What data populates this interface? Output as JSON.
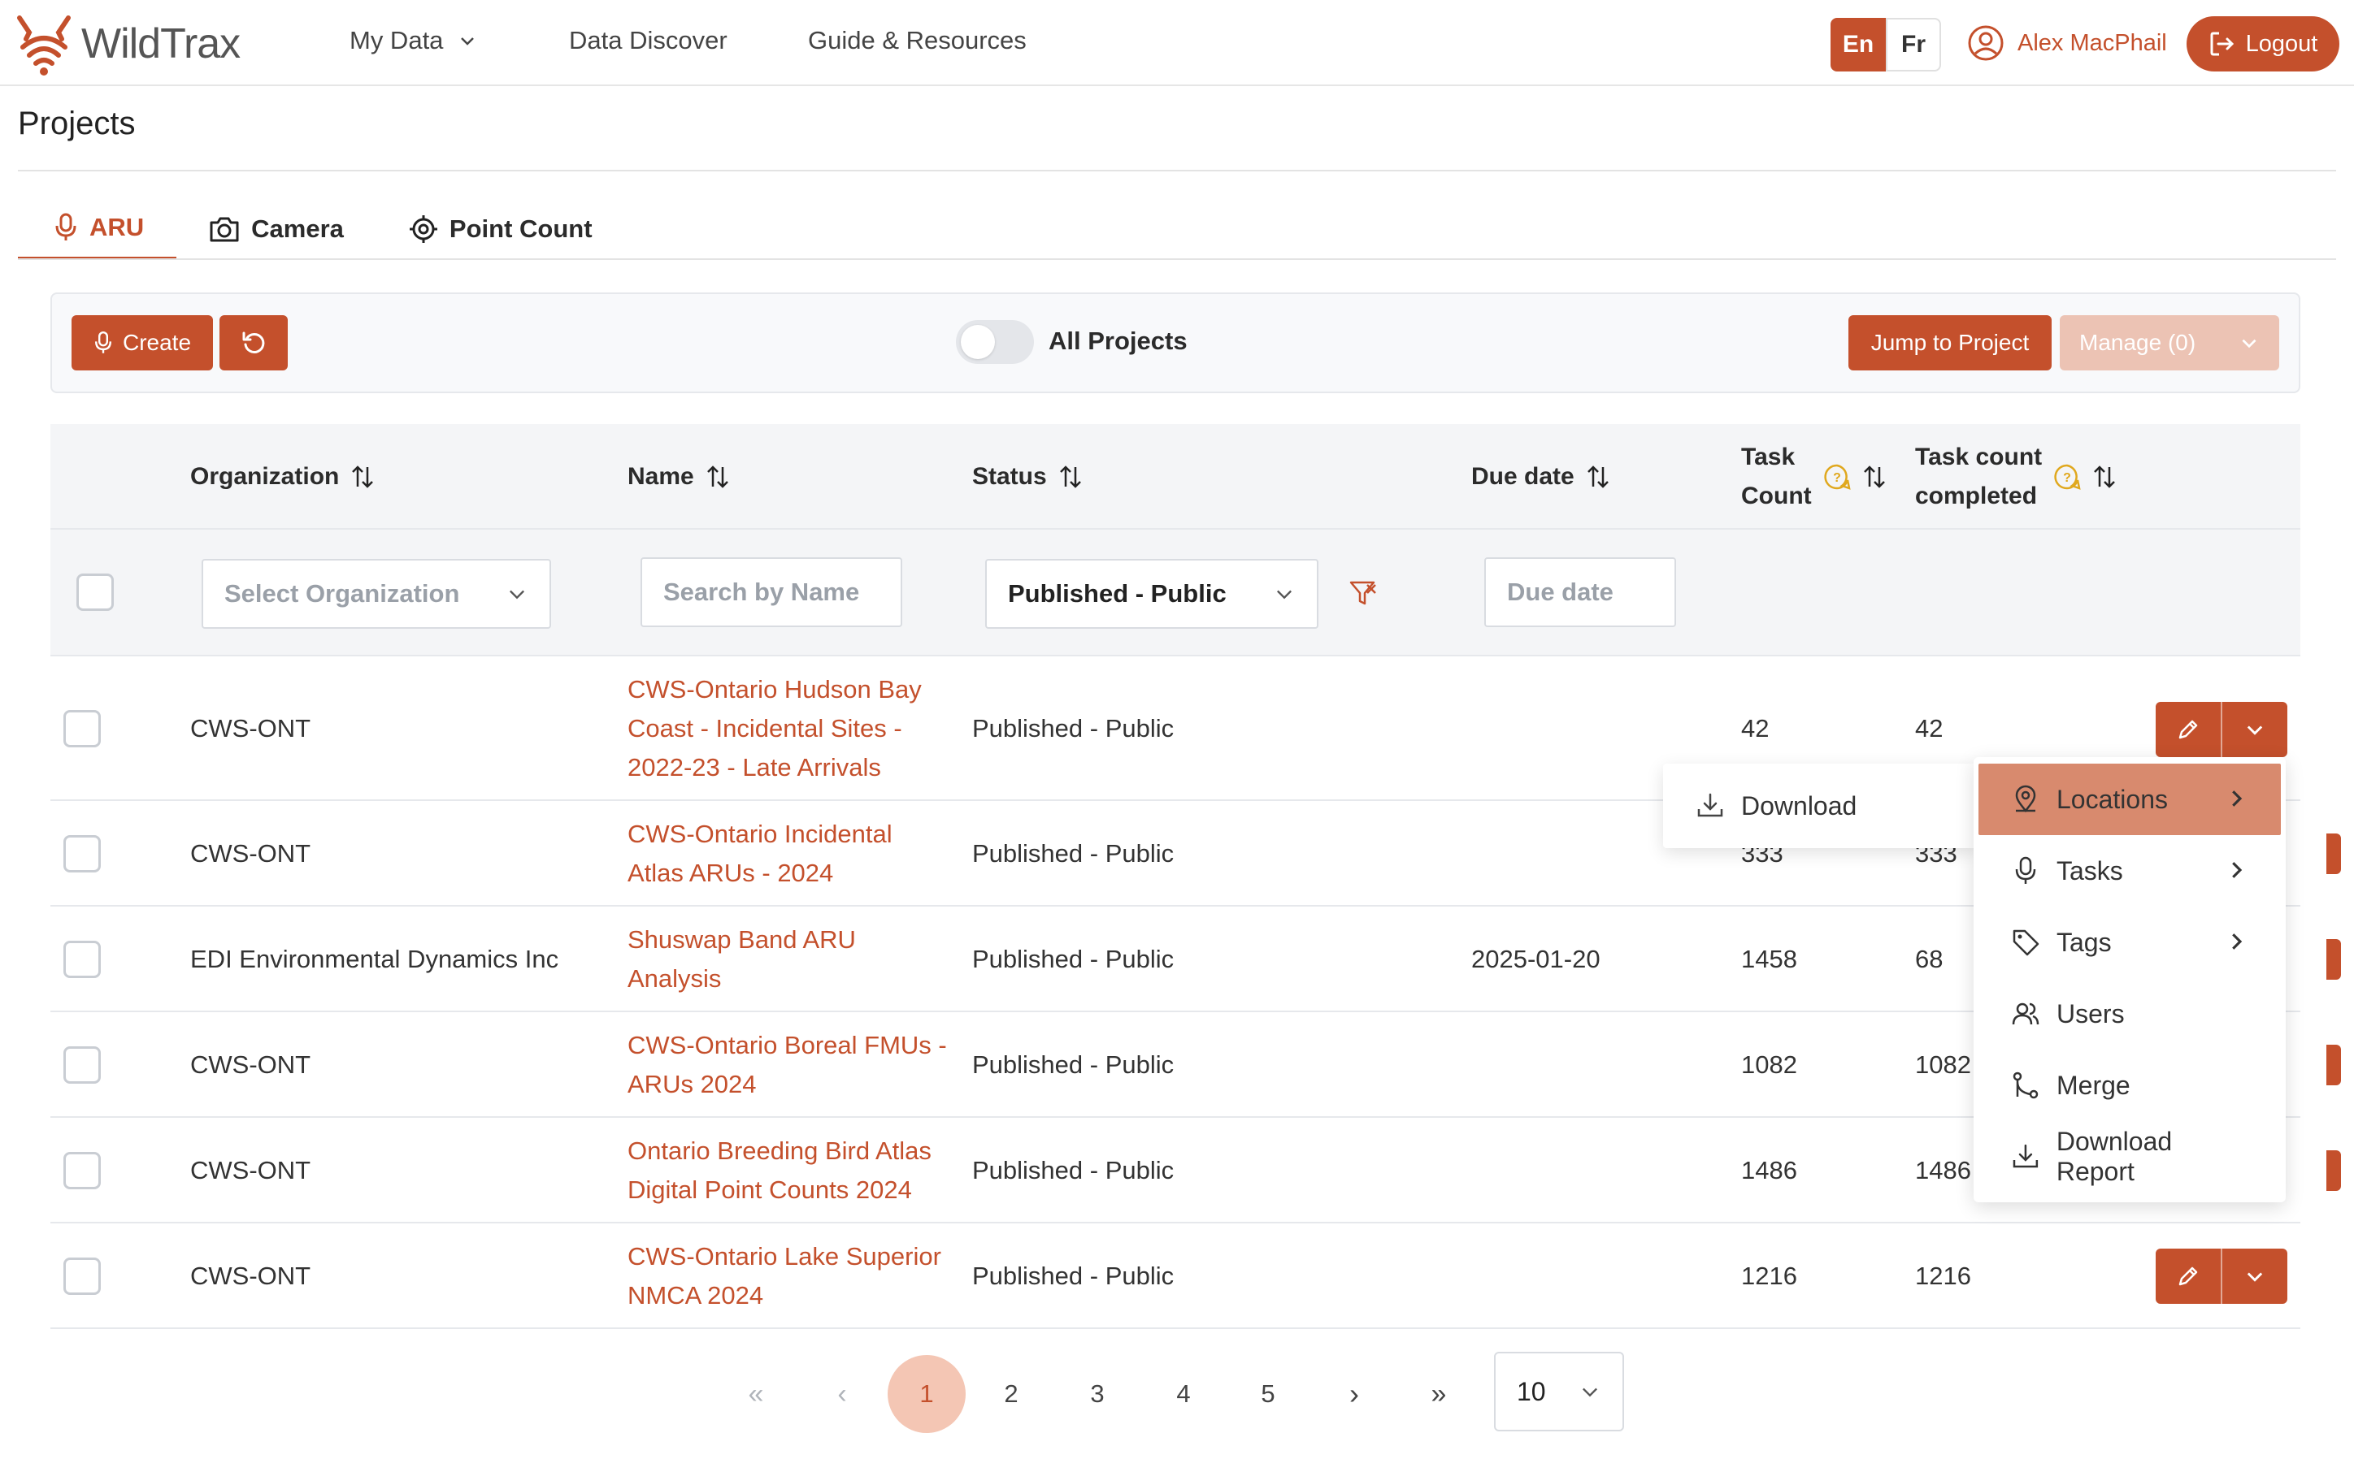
{
  "brand": {
    "name": "WildTrax",
    "accent": "#c4502c",
    "accent_light": "#f4c6b4"
  },
  "nav": {
    "items": [
      "My Data",
      "Data Discover",
      "Guide & Resources"
    ],
    "lang": {
      "en": "En",
      "fr": "Fr",
      "active": "En"
    },
    "user_name": "Alex MacPhail",
    "logout": "Logout"
  },
  "page": {
    "title": "Projects"
  },
  "tabs": [
    {
      "label": "ARU",
      "icon": "microphone-icon",
      "active": true
    },
    {
      "label": "Camera",
      "icon": "camera-icon",
      "active": false
    },
    {
      "label": "Point Count",
      "icon": "crosshair-icon",
      "active": false
    }
  ],
  "toolbar": {
    "create": "Create",
    "all_projects": "All Projects",
    "all_projects_on": false,
    "jump": "Jump to Project",
    "manage": "Manage (0)"
  },
  "table": {
    "headers": {
      "organization": "Organization",
      "name": "Name",
      "status": "Status",
      "due_date": "Due date",
      "task_count_1": "Task",
      "task_count_2": "Count",
      "task_completed_1": "Task count",
      "task_completed_2": "completed"
    },
    "filters": {
      "organization_placeholder": "Select Organization",
      "name_placeholder": "Search by Name",
      "status_value": "Published - Public",
      "due_placeholder": "Due date"
    },
    "rows": [
      {
        "organization": "CWS-ONT",
        "name": [
          "CWS-Ontario Hudson Bay",
          "Coast - Incidental Sites -",
          "2022-23 - Late Arrivals"
        ],
        "status": "Published - Public",
        "due": "",
        "tasks": "42",
        "completed": "42"
      },
      {
        "organization": "CWS-ONT",
        "name": [
          "CWS-Ontario Incidental",
          "Atlas ARUs - 2024"
        ],
        "status": "Published - Public",
        "due": "",
        "tasks": "333",
        "completed": "333"
      },
      {
        "organization": "EDI Environmental Dynamics Inc",
        "name": [
          "Shuswap Band ARU",
          "Analysis"
        ],
        "status": "Published - Public",
        "due": "2025-01-20",
        "tasks": "1458",
        "completed": "68"
      },
      {
        "organization": "CWS-ONT",
        "name": [
          "CWS-Ontario Boreal FMUs -",
          "ARUs 2024"
        ],
        "status": "Published - Public",
        "due": "",
        "tasks": "1082",
        "completed": "1082"
      },
      {
        "organization": "CWS-ONT",
        "name": [
          "Ontario Breeding Bird Atlas",
          "Digital Point Counts 2024"
        ],
        "status": "Published - Public",
        "due": "",
        "tasks": "1486",
        "completed": "1486"
      },
      {
        "organization": "CWS-ONT",
        "name": [
          "CWS-Ontario Lake Superior",
          "NMCA 2024"
        ],
        "status": "Published - Public",
        "due": "",
        "tasks": "1216",
        "completed": "1216"
      }
    ]
  },
  "download_menu": {
    "label": "Download"
  },
  "actions_menu": [
    {
      "label": "Locations",
      "icon": "location-icon",
      "submenu": true,
      "highlighted": true
    },
    {
      "label": "Tasks",
      "icon": "microphone-icon",
      "submenu": true,
      "highlighted": false
    },
    {
      "label": "Tags",
      "icon": "tag-icon",
      "submenu": true,
      "highlighted": false
    },
    {
      "label": "Users",
      "icon": "users-icon",
      "submenu": false,
      "highlighted": false
    },
    {
      "label": "Merge",
      "icon": "merge-icon",
      "submenu": false,
      "highlighted": false
    },
    {
      "label": "Download Report",
      "icon": "download-icon",
      "submenu": false,
      "highlighted": false
    }
  ],
  "pagination": {
    "pages": [
      "1",
      "2",
      "3",
      "4",
      "5"
    ],
    "current": "1",
    "page_size": "10"
  }
}
